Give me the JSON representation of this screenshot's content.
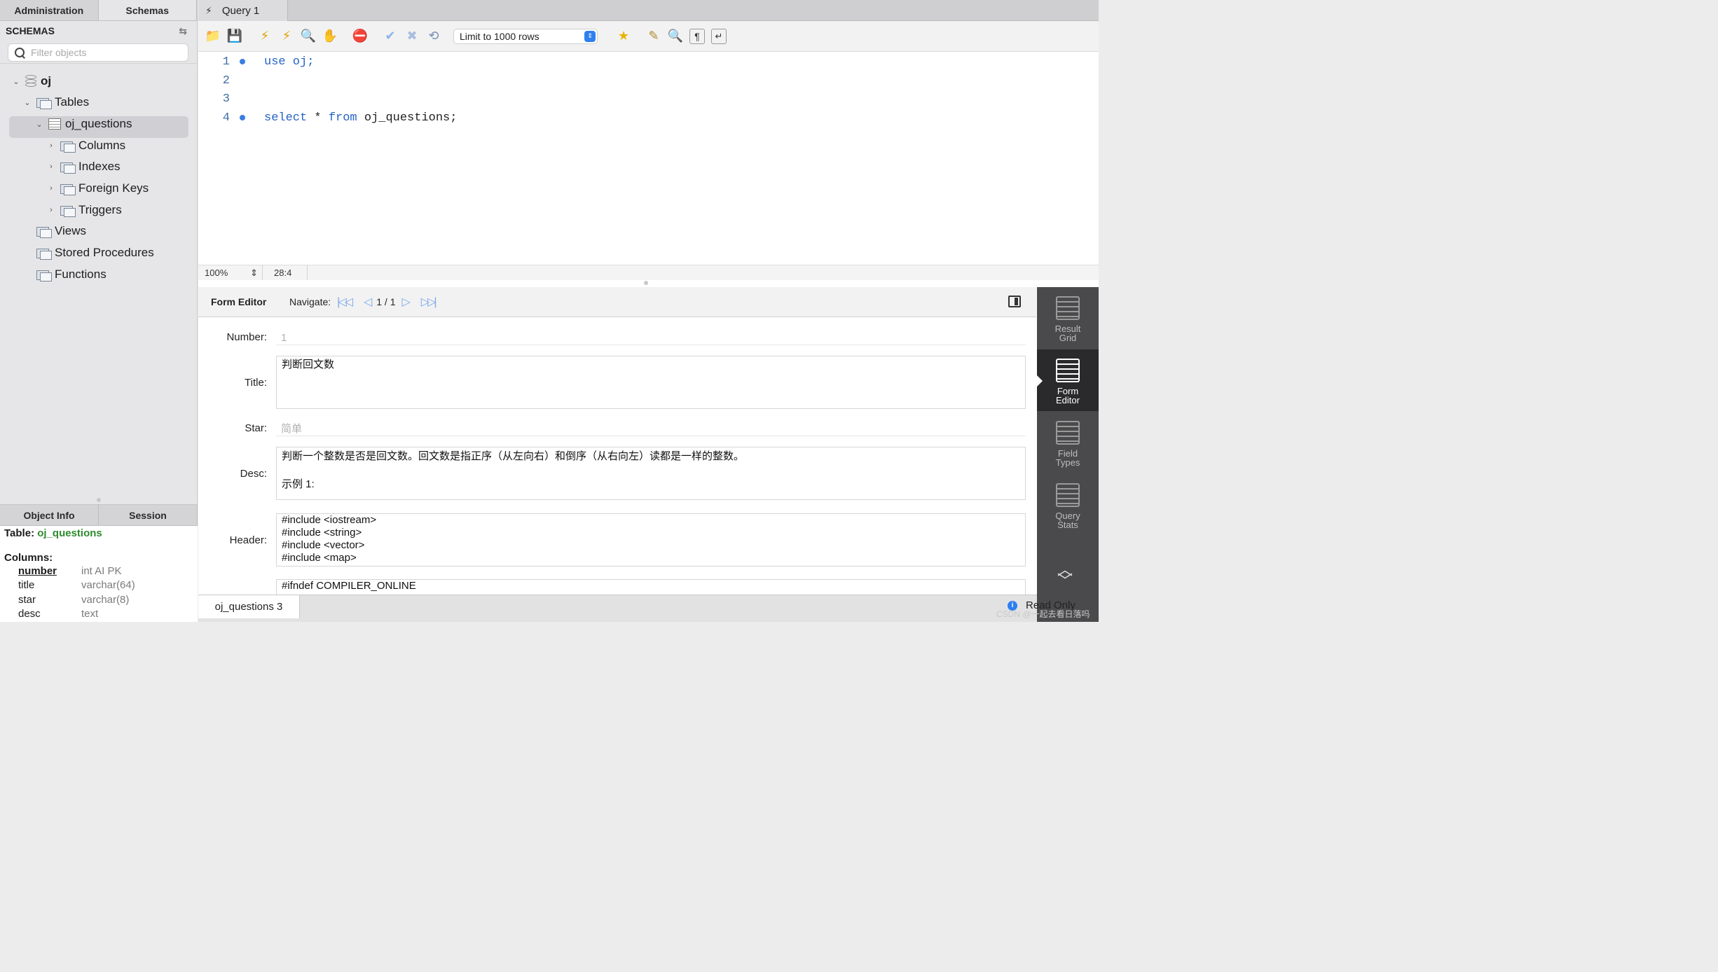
{
  "sidebar": {
    "tabs": [
      "Administration",
      "Schemas"
    ],
    "header": "SCHEMAS",
    "filter_placeholder": "Filter objects",
    "tree": {
      "schema": "oj",
      "tables": "Tables",
      "table": "oj_questions",
      "table_children": [
        "Columns",
        "Indexes",
        "Foreign Keys",
        "Triggers"
      ],
      "views": "Views",
      "procedures": "Stored Procedures",
      "functions": "Functions"
    },
    "bottom_tabs": [
      "Object Info",
      "Session"
    ],
    "object_info": {
      "table_label": "Table:",
      "table_name": "oj_questions",
      "columns_label": "Columns:",
      "columns": [
        {
          "name": "number",
          "type": "int AI PK"
        },
        {
          "name": "title",
          "type": "varchar(64)"
        },
        {
          "name": "star",
          "type": "varchar(8)"
        },
        {
          "name": "desc",
          "type": "text"
        }
      ]
    }
  },
  "main": {
    "query_tab": "Query 1",
    "limit_select": "Limit to 1000 rows",
    "editor": {
      "lines": [
        {
          "num": "1",
          "kw": "use",
          "rest": " oj;"
        },
        {
          "num": "2",
          "kw": "",
          "rest": ""
        },
        {
          "num": "3",
          "kw": "",
          "rest": ""
        },
        {
          "num": "4",
          "kw": "select",
          "rest": " * ",
          "kw2": "from",
          "rest2": " oj_questions;"
        }
      ]
    },
    "status": {
      "zoom": "100%",
      "cursor": "28:4"
    },
    "form": {
      "title": "Form Editor",
      "navigate_label": "Navigate:",
      "record": "1 / 1",
      "fields": {
        "number_label": "Number:",
        "number": "1",
        "title_label": "Title:",
        "title": "判断回文数",
        "star_label": "Star:",
        "star": "简单",
        "desc_label": "Desc:",
        "desc": "判断一个整数是否是回文数。回文数是指正序（从左向右）和倒序（从右向左）读都是一样的整数。\n\n示例 1:",
        "header_label": "Header:",
        "header": "#include <iostream>\n#include <string>\n#include <vector>\n#include <map>",
        "tail": "#ifndef COMPILER_ONLINE"
      }
    },
    "right_tabs": [
      {
        "line1": "Result",
        "line2": "Grid"
      },
      {
        "line1": "Form",
        "line2": "Editor"
      },
      {
        "line1": "Field",
        "line2": "Types"
      },
      {
        "line1": "Query",
        "line2": "Stats"
      }
    ],
    "result_tab": "oj_questions 3",
    "read_only": "Read Only",
    "watermark": "CSDN @一起去看日落吗"
  },
  "colors": {
    "accent": "#2f7ff0",
    "keyword": "#2563c4",
    "table_name": "#2e8b2e"
  }
}
